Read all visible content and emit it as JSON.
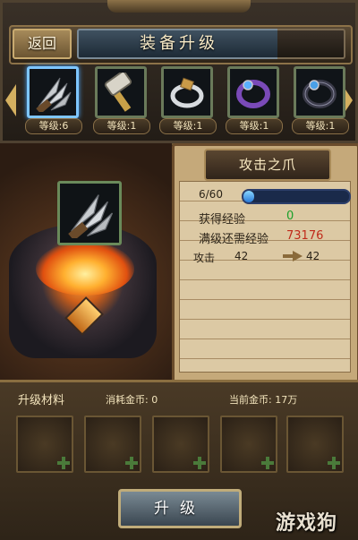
{
  "header": {
    "back_label": "返回",
    "title": "装备升级"
  },
  "equipment": [
    {
      "name": "claw",
      "icon": "claw-icon",
      "level_label": "等级:6",
      "selected": true
    },
    {
      "name": "hammer",
      "icon": "hammer-icon",
      "level_label": "等级:1",
      "selected": false
    },
    {
      "name": "silver ring",
      "icon": "silver-ring-icon",
      "level_label": "等级:1",
      "selected": false
    },
    {
      "name": "purple ring",
      "icon": "purple-ring-icon",
      "level_label": "等级:1",
      "selected": false
    },
    {
      "name": "dark ring",
      "icon": "dark-ring-icon",
      "level_label": "等级:1",
      "selected": false
    }
  ],
  "info": {
    "item_name": "攻击之爪",
    "exp_text": "6/60",
    "exp_fraction": 0.1,
    "gain_exp_label": "获得经验",
    "gain_exp_value": "0",
    "need_exp_label": "满级还需经验",
    "need_exp_value": "73176",
    "stat_label": "攻击",
    "stat_current": "42",
    "stat_next": "42"
  },
  "materials": {
    "title": "升级材料",
    "cost_label": "消耗金币: 0",
    "gold_label": "当前金币: 17万",
    "slot_count": 5
  },
  "upgrade_button": "升级",
  "watermark": "游戏狗",
  "colors": {
    "selected_border": "#7ec6ff",
    "exp_bar": "#2a7ad8",
    "gain_green": "#1aa02a",
    "need_red": "#c02a1a"
  }
}
